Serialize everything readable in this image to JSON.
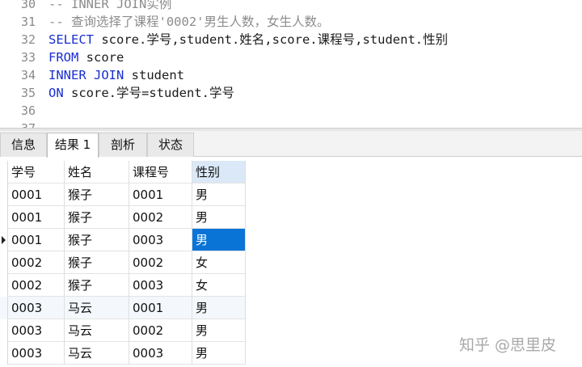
{
  "editor": {
    "lines": [
      {
        "num": "30",
        "text": "-- INNER JOIN实例"
      },
      {
        "num": "31",
        "text": "-- 查询选择了课程'0002'男生人数，女生人数。"
      },
      {
        "num": "32",
        "kw": "SELECT",
        "text": " score.学号,student.姓名,score.课程号,student.性别"
      },
      {
        "num": "33",
        "kw": "FROM",
        "text": " score"
      },
      {
        "num": "34",
        "kw": "INNER JOIN",
        "text": " student"
      },
      {
        "num": "35",
        "kw": "ON",
        "text": " score.学号=student.学号"
      },
      {
        "num": "36",
        "text": ""
      },
      {
        "num": "37",
        "text": ""
      }
    ]
  },
  "tabs": [
    "信息",
    "结果 1",
    "剖析",
    "状态"
  ],
  "active_tab": "结果 1",
  "grid": {
    "columns": [
      "学号",
      "姓名",
      "课程号",
      "性别"
    ],
    "rows": [
      [
        "0001",
        "猴子",
        "0001",
        "男"
      ],
      [
        "0001",
        "猴子",
        "0002",
        "男"
      ],
      [
        "0001",
        "猴子",
        "0003",
        "男"
      ],
      [
        "0002",
        "猴子",
        "0002",
        "女"
      ],
      [
        "0002",
        "猴子",
        "0003",
        "女"
      ],
      [
        "0003",
        "马云",
        "0001",
        "男"
      ],
      [
        "0003",
        "马云",
        "0002",
        "男"
      ],
      [
        "0003",
        "马云",
        "0003",
        "男"
      ]
    ],
    "current_row_index": 2,
    "selected_column_index": 3
  },
  "watermark": "知乎 @思里皮",
  "colors": {
    "keyword": "#1a2ed1",
    "comment": "#8c8c8c",
    "selection": "#0a74d6",
    "selected_header": "#dbe8f7"
  }
}
